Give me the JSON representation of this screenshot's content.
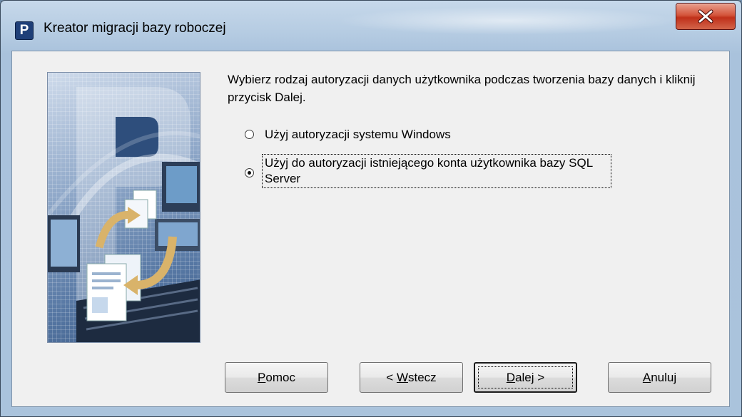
{
  "window": {
    "title": "Kreator migracji bazy roboczej",
    "app_icon_letter": "P",
    "close_icon": "close-x-icon"
  },
  "content": {
    "instruction": "Wybierz rodzaj autoryzacji danych użytkownika podczas tworzenia bazy danych i kliknij przycisk Dalej.",
    "options": [
      {
        "label": "Użyj autoryzacji systemu Windows",
        "selected": false
      },
      {
        "label": "Użyj do autoryzacji istniejącego konta użytkownika bazy SQL Server",
        "selected": true
      }
    ]
  },
  "buttons": {
    "help": {
      "prefix": "",
      "accel": "P",
      "rest": "omoc"
    },
    "back": {
      "prefix": "< ",
      "accel": "W",
      "rest": "stecz"
    },
    "next": {
      "prefix": "",
      "accel": "D",
      "rest": "alej >"
    },
    "cancel": {
      "prefix": "",
      "accel": "A",
      "rest": "nuluj"
    }
  },
  "colors": {
    "dialog_bg": "#f0f0f0",
    "frame": "#b7cde3",
    "close_red": "#c0301a"
  }
}
